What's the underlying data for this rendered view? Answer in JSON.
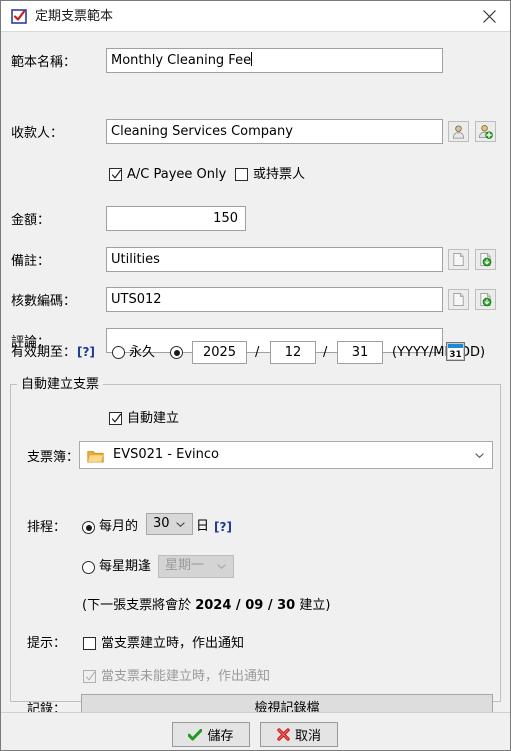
{
  "window": {
    "title": "定期支票範本",
    "title_icon": "check-template-icon",
    "close_icon": "close-icon"
  },
  "fields": {
    "template_name": {
      "label": "範本名稱：",
      "value": "Monthly Cleaning Fee"
    },
    "payee": {
      "label": "收款人：",
      "value": "Cleaning Services Company",
      "button1_icon": "person-icon",
      "button2_icon": "person-add-icon"
    },
    "ac_payee_only": {
      "label": "A/C Payee Only",
      "checked": true
    },
    "or_bearer": {
      "label": "或持票人",
      "checked": false
    },
    "amount": {
      "label": "金額：",
      "value": "150"
    },
    "memo": {
      "label": "備註：",
      "value": "Utilities",
      "button1_icon": "page-icon",
      "button2_icon": "page-save-icon"
    },
    "audit_code": {
      "label": "核數編碼：",
      "value": "UTS012",
      "button1_icon": "page-icon",
      "button2_icon": "page-save-icon"
    },
    "comment": {
      "label": "評論：",
      "value": ""
    },
    "valid_until": {
      "label": "有效期至：",
      "help": "[?]",
      "forever_label": "永久",
      "forever_selected": false,
      "date_selected": true,
      "year": "2025",
      "month": "12",
      "day": "31",
      "separator": "/",
      "format_hint": "(YYYY/MM/DD)",
      "calendar_icon": "calendar-icon",
      "calendar_icon_text": "31"
    }
  },
  "auto_create_group": {
    "title": "自動建立支票",
    "auto_create": {
      "label": "自動建立",
      "checked": true
    },
    "chequebook": {
      "label": "支票簿：",
      "value": "EVS021 - Evinco",
      "icon": "folder-icon",
      "chevron_icon": "chevron-down-icon"
    },
    "schedule": {
      "label": "排程：",
      "monthly": {
        "label_prefix": "每月的",
        "label_suffix": "日",
        "day": "30",
        "selected": true,
        "help": "[?]",
        "chevron_icon": "chevron-down-icon"
      },
      "weekly": {
        "label": "每星期逢",
        "weekday": "星期一",
        "selected": false,
        "chevron_icon": "chevron-down-icon"
      },
      "next_note_prefix": "(下一張支票將會於 ",
      "next_note_date": "2024 / 09 / 30",
      "next_note_suffix": " 建立)"
    },
    "alerts": {
      "label": "提示：",
      "on_created": {
        "label": "當支票建立時，作出通知",
        "checked": false,
        "disabled": false
      },
      "on_failed": {
        "label": "當支票未能建立時，作出通知",
        "checked": true,
        "disabled": true
      }
    },
    "log": {
      "label": "記錄：",
      "button_label": "檢視記錄檔"
    }
  },
  "footer": {
    "save_label": "儲存",
    "save_icon": "green-check-icon",
    "cancel_label": "取消",
    "cancel_icon": "red-x-icon"
  },
  "colors": {
    "window_bg": "#f0f0f0",
    "titlebar_bg": "#ffffff",
    "field_bg": "#ffffff",
    "border": "#a0a0a0",
    "help_link": "#1f3a93",
    "accent_green": "#2aa02a",
    "accent_red": "#cc2222",
    "folder_orange": "#f3b33d"
  }
}
